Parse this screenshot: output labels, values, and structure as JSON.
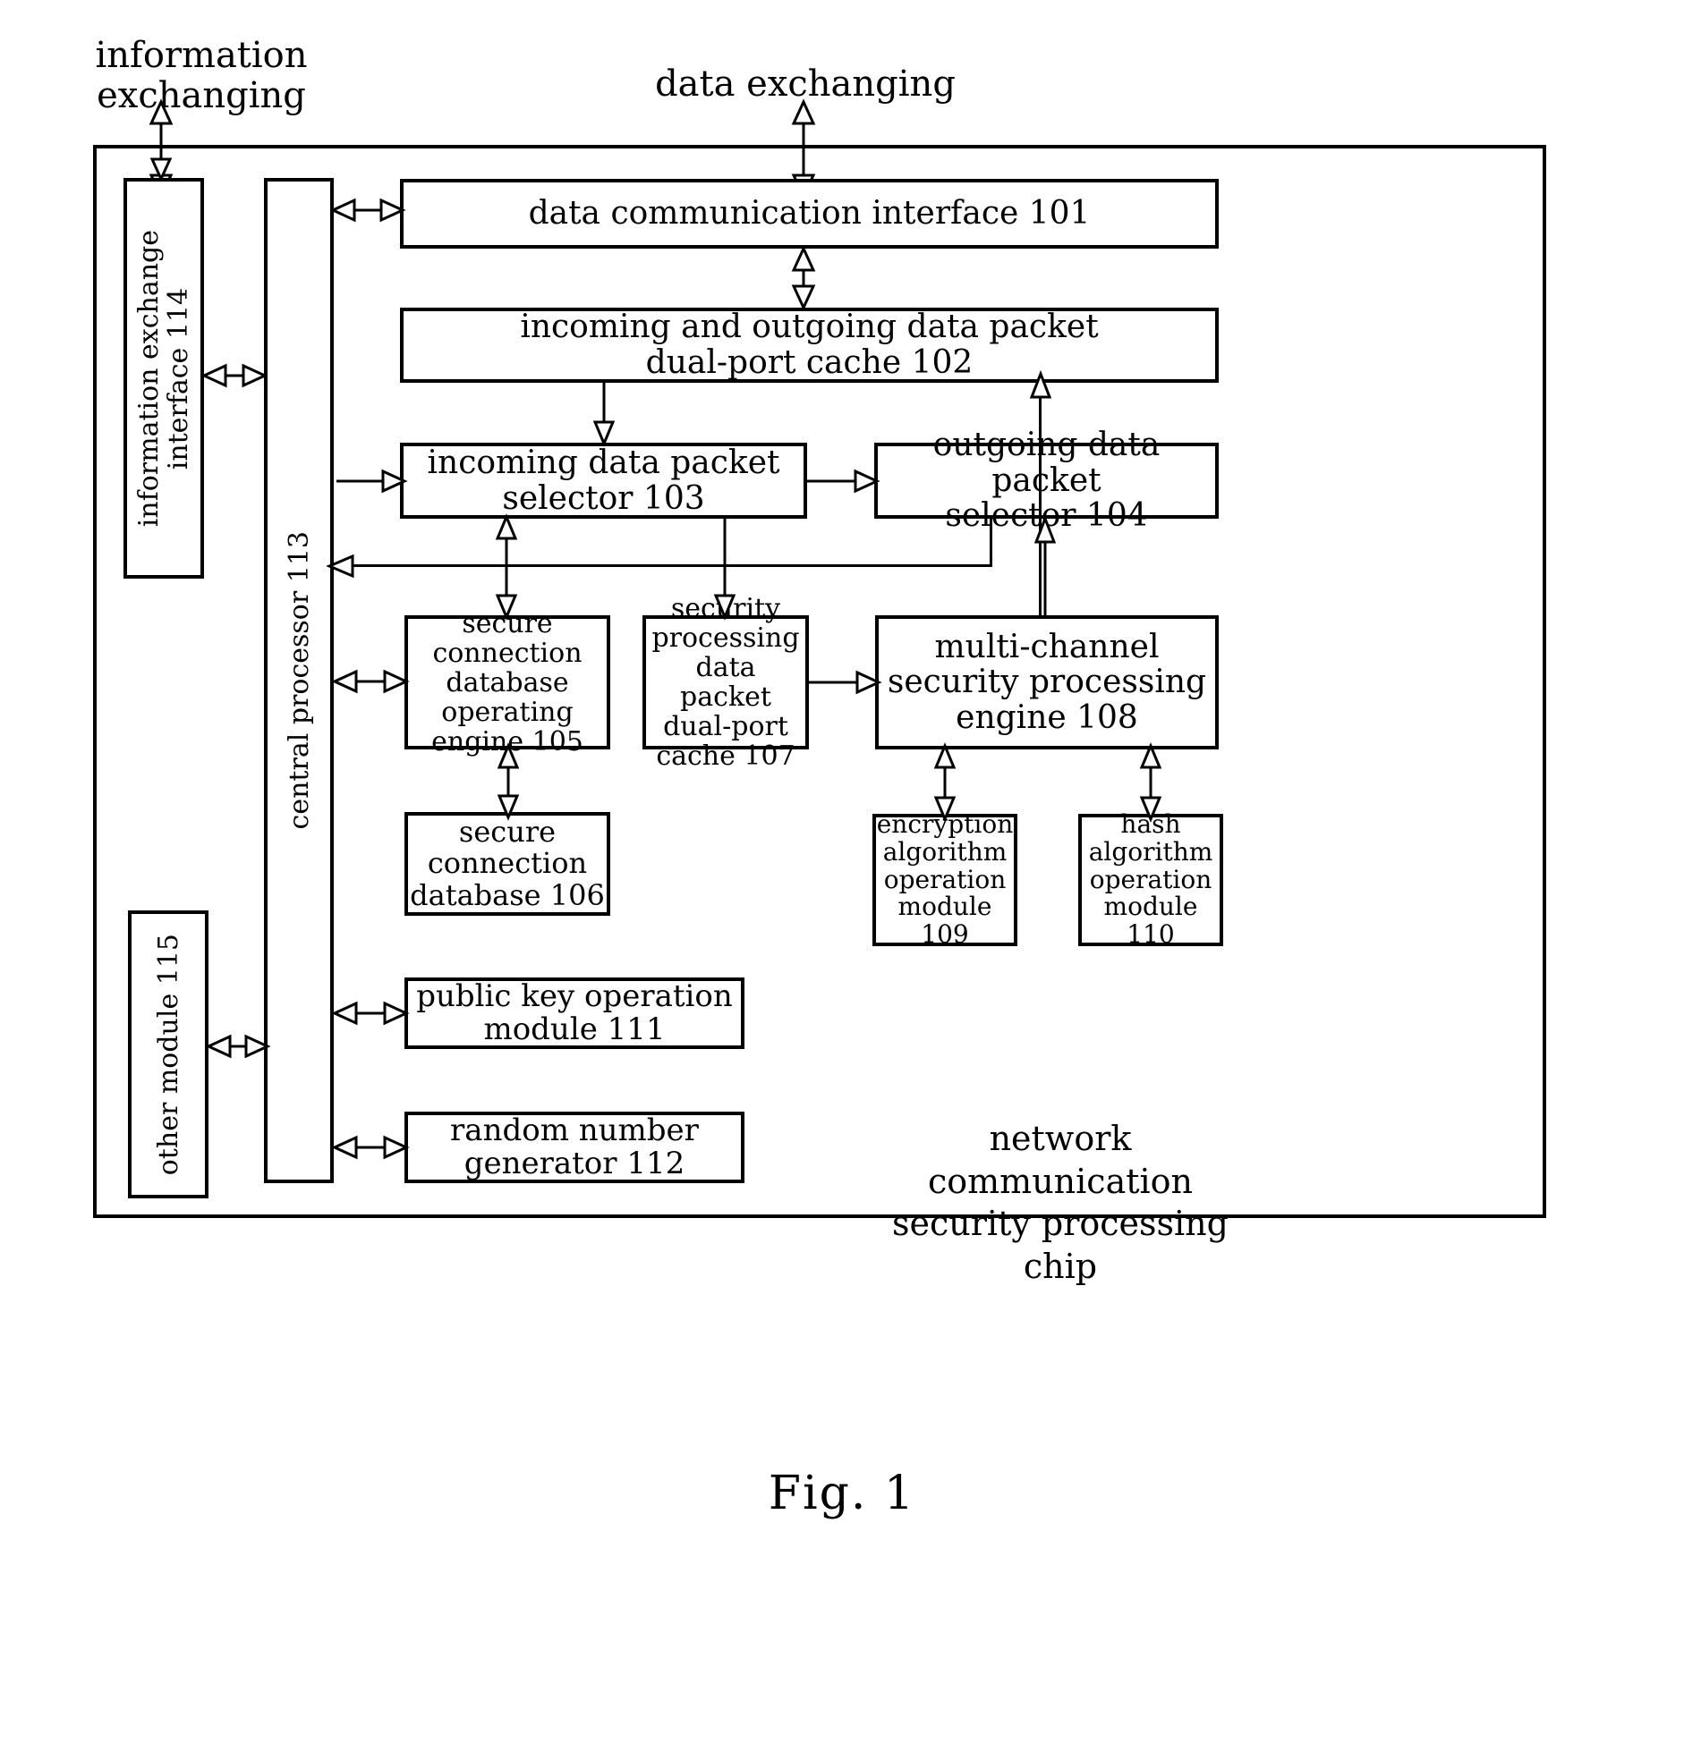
{
  "figure": {
    "caption": "Fig. 1",
    "chip_label": "network communication\nsecurity processing chip"
  },
  "external_labels": {
    "information_exchanging": "information\nexchanging",
    "data_exchanging": "data exchanging"
  },
  "blocks": {
    "b101": {
      "label": "data communication interface 101",
      "ref": "101"
    },
    "b102": {
      "label": "incoming and outgoing data packet\ndual-port cache 102",
      "ref": "102"
    },
    "b103": {
      "label": "incoming data packet\nselector 103",
      "ref": "103"
    },
    "b104": {
      "label": "outgoing data packet\nselector 104",
      "ref": "104"
    },
    "b105": {
      "label": "secure\nconnection\ndatabase\noperating\nengine 105",
      "ref": "105"
    },
    "b106": {
      "label": "secure\nconnection\ndatabase 106",
      "ref": "106"
    },
    "b107": {
      "label": "security\nprocessing\ndata packet\ndual-port\ncache 107",
      "ref": "107"
    },
    "b108": {
      "label": "multi-channel\nsecurity processing\nengine 108",
      "ref": "108"
    },
    "b109": {
      "label": "encryption\nalgorithm\noperation\nmodule 109",
      "ref": "109"
    },
    "b110": {
      "label": "hash\nalgorithm\noperation\nmodule 110",
      "ref": "110"
    },
    "b111": {
      "label": "public key operation\nmodule 111",
      "ref": "111"
    },
    "b112": {
      "label": "random number\ngenerator 112",
      "ref": "112"
    },
    "b113": {
      "label": "central processor 113",
      "ref": "113"
    },
    "b114": {
      "label": "information exchange\ninterface 114",
      "ref": "114"
    },
    "b115": {
      "label": "other module 115",
      "ref": "115"
    }
  },
  "colors": {
    "stroke": "#000000",
    "background": "#ffffff"
  }
}
